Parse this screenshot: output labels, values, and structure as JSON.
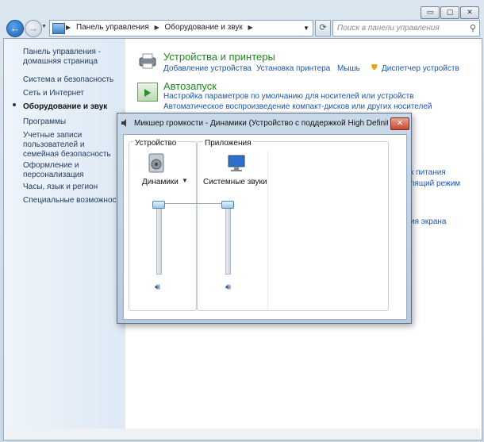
{
  "window": {
    "controls": {
      "minimize": "▭",
      "maximize": "▢",
      "close": "✕"
    }
  },
  "nav": {
    "breadcrumb": [
      "Панель управления",
      "Оборудование и звук"
    ],
    "search_placeholder": "Поиск в панели управления"
  },
  "left_nav": {
    "home": "Панель управления - домашняя страница",
    "items": [
      "Система и безопасность",
      "Сеть и Интернет",
      "Оборудование и звук",
      "Программы",
      "Учетные записи пользователей и семейная безопасность",
      "Оформление и персонализация",
      "Часы, язык и регион",
      "Специальные возможности"
    ],
    "selected": "Оборудование и звук"
  },
  "content": {
    "devices": {
      "title": "Устройства и принтеры",
      "links": [
        "Добавление устройства",
        "Установка принтера",
        "Мышь",
        "Диспетчер устройств"
      ]
    },
    "autoplay": {
      "title": "Автозапуск",
      "links": [
        "Настройка параметров по умолчанию для носителей или устройств",
        "Автоматическое воспроизведение компакт-дисков или других носителей"
      ]
    },
    "partial_links": [
      "к питания",
      "пящий режим",
      "ия экрана"
    ]
  },
  "mixer": {
    "title": "Микшер громкости - Динамики (Устройство с поддержкой High Definition",
    "device_group": "Устройство",
    "apps_group": "Приложения",
    "device_name": "Динамики",
    "app_name": "Системные звуки",
    "device_volume": 1.0,
    "app_volume": 1.0,
    "icons": {
      "speaker": "speaker-icon",
      "monitor": "monitor-icon",
      "mute": "volume-icon"
    }
  }
}
